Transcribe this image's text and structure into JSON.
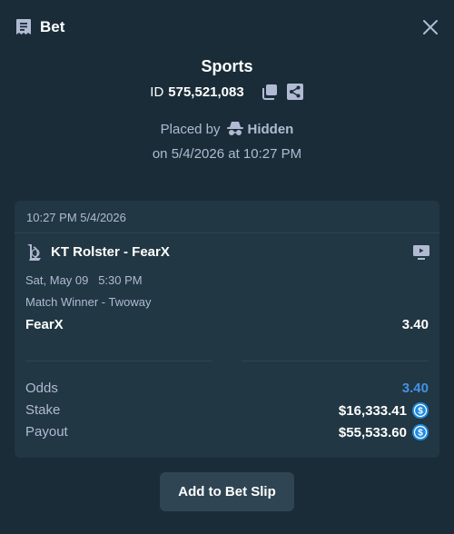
{
  "header": {
    "title": "Bet"
  },
  "bet": {
    "sport": "Sports",
    "id_label": "ID",
    "id_value": "575,521,083",
    "placed_by_label": "Placed by",
    "placed_by_user": "Hidden",
    "placed_on": "on 5/4/2026 at 10:27 PM"
  },
  "card": {
    "timestamp": "10:27 PM 5/4/2026",
    "event_name": "KT Rolster - FearX",
    "event_date": "Sat, May 09   5:30 PM",
    "market": "Match Winner - Twoway",
    "selection": "FearX",
    "selection_odds": "3.40"
  },
  "summary": {
    "odds_label": "Odds",
    "odds_value": "3.40",
    "stake_label": "Stake",
    "stake_value": "$16,333.41",
    "payout_label": "Payout",
    "payout_value": "$55,533.60"
  },
  "actions": {
    "add_to_slip": "Add to Bet Slip"
  },
  "colors": {
    "background": "#1a2c38",
    "card": "#213743",
    "accent": "#4391e7",
    "button": "#2f4553",
    "coin": "#1f8ae0"
  },
  "icons": [
    "bet-slip-icon",
    "close-icon",
    "copy-icon",
    "share-icon",
    "incognito-icon",
    "league-of-legends-icon",
    "stream-icon",
    "usdc-coin-icon"
  ]
}
